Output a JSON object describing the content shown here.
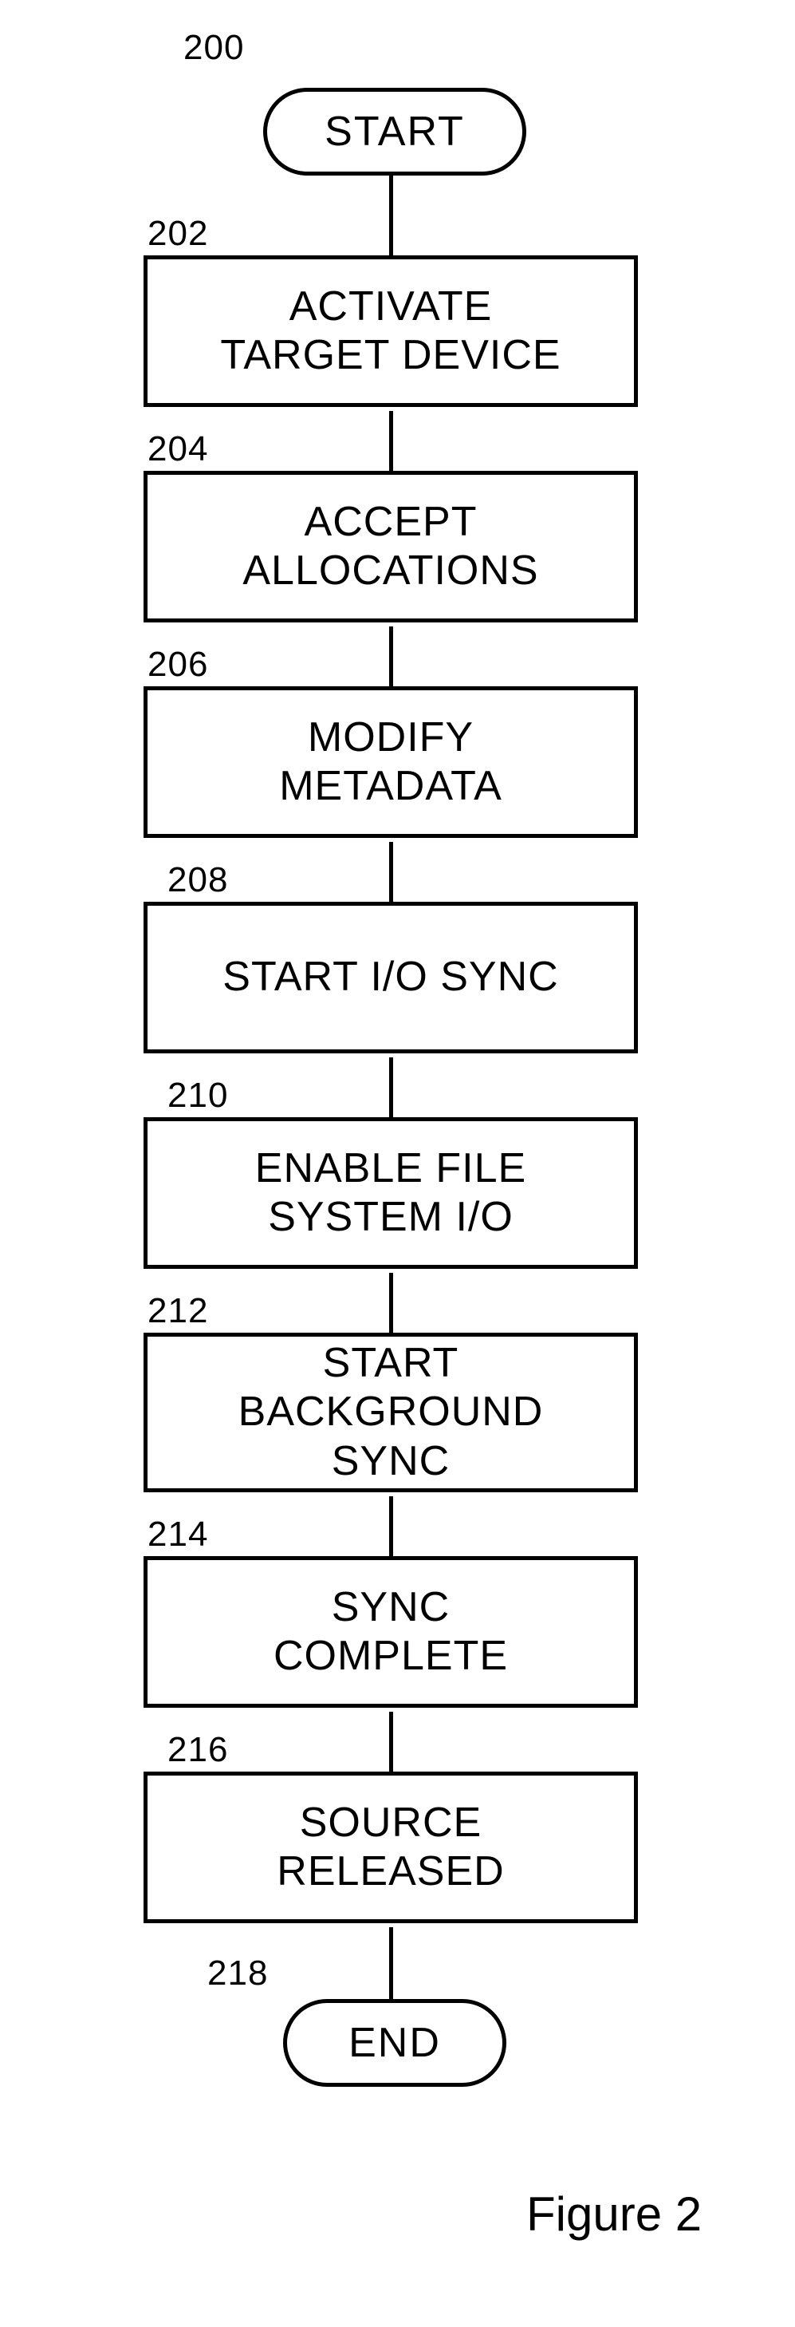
{
  "refs": {
    "r200": "200",
    "r202": "202",
    "r204": "204",
    "r206": "206",
    "r208": "208",
    "r210": "210",
    "r212": "212",
    "r214": "214",
    "r216": "216",
    "r218": "218"
  },
  "nodes": {
    "start": "START",
    "activate": "ACTIVATE\nTARGET DEVICE",
    "accept": "ACCEPT\nALLOCATIONS",
    "modify": "MODIFY\nMETADATA",
    "startio": "START I/O SYNC",
    "enablefs": "ENABLE FILE\nSYSTEM I/O",
    "startbg": "START\nBACKGROUND\nSYNC",
    "synccomplete": "SYNC\nCOMPLETE",
    "released": "SOURCE\nRELEASED",
    "end": "END"
  },
  "caption": "Figure 2"
}
